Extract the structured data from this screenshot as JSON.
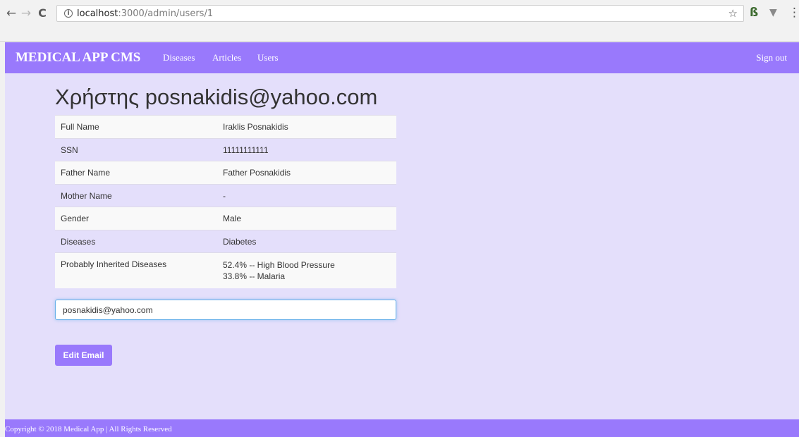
{
  "browser": {
    "url_host": "localhost",
    "url_path": ":3000/admin/users/1",
    "back_icon": "←",
    "forward_icon": "→",
    "reload_icon": "C",
    "info_icon": "i",
    "star_icon": "☆",
    "ext_b_icon": "ß",
    "ext_v_icon": "▼",
    "menu_icon": "⋮"
  },
  "navbar": {
    "brand": "MEDICAL APP CMS",
    "links": [
      "Diseases",
      "Articles",
      "Users"
    ],
    "sign_out": "Sign out",
    "color": "#9979fc"
  },
  "page_title": "Χρήστης posnakidis@yahoo.com",
  "user_details": [
    {
      "label": "Full Name",
      "value": "Iraklis Posnakidis"
    },
    {
      "label": "SSN",
      "value": "11111111111"
    },
    {
      "label": "Father Name",
      "value": "Father Posnakidis"
    },
    {
      "label": "Mother Name",
      "value": "-"
    },
    {
      "label": "Gender",
      "value": "Male"
    },
    {
      "label": "Diseases",
      "value": "Diabetes"
    },
    {
      "label": "Probably Inherited Diseases",
      "values": [
        "52.4% -- High Blood Pressure",
        "33.8% -- Malaria"
      ]
    }
  ],
  "email_input": {
    "value": "posnakidis@yahoo.com"
  },
  "edit_button": "Edit Email",
  "footer": {
    "copyright": "Copyright © 2018 Medical App | All Rights Reserved"
  },
  "colors": {
    "accent": "#9979fc",
    "background": "#e4dffb"
  }
}
